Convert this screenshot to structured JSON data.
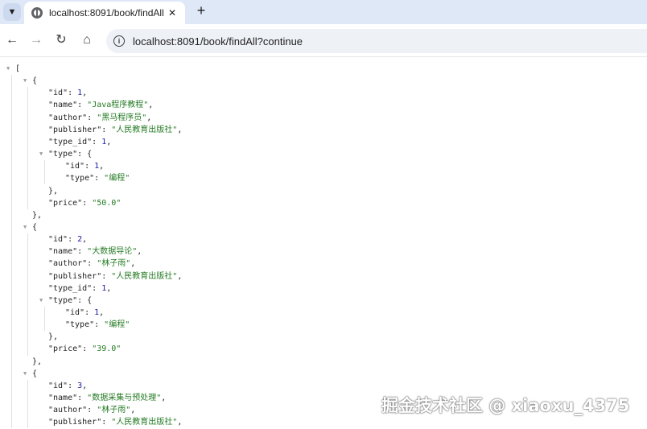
{
  "browser": {
    "tab_menu_icon": "chevron-down-icon",
    "tab_title": "localhost:8091/book/findAll?",
    "url": "localhost:8091/book/findAll?continue"
  },
  "json_viewer": {
    "books": [
      {
        "id": "1",
        "name": "\"Java程序教程\"",
        "author": "\"黑马程序员\"",
        "publisher": "\"人民教育出版社\"",
        "type_id": "1",
        "type": {
          "id": "1",
          "type": "\"编程\""
        },
        "price": "\"50.0\""
      },
      {
        "id": "2",
        "name": "\"大数据导论\"",
        "author": "\"林子雨\"",
        "publisher": "\"人民教育出版社\"",
        "type_id": "1",
        "type": {
          "id": "1",
          "type": "\"编程\""
        },
        "price": "\"39.0\""
      },
      {
        "id": "3",
        "name": "\"数据采集与预处理\"",
        "author": "\"林子雨\"",
        "publisher": "\"人民教育出版社\""
      }
    ]
  },
  "watermark": "掘金技术社区 @ xiaoxu_4375"
}
